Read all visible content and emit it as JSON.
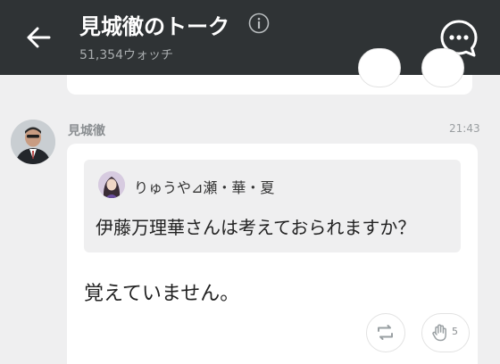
{
  "header": {
    "title": "見城徹のトーク",
    "watch_count": "51,354ウォッチ",
    "bg_color": "#2f3335",
    "icons": [
      "back-arrow-icon",
      "info-icon",
      "chat-bubble-icon"
    ]
  },
  "message": {
    "sender": "見城徹",
    "time": "21:43",
    "quote": {
      "name": "りゅうや⊿瀬・華・夏",
      "text": "伊藤万理華さんは考えておられますか？"
    },
    "text": "覚えていません。",
    "likes": "5",
    "icons": [
      "repost-icon",
      "clap-icon"
    ]
  },
  "colors": {
    "background": "#efeff0",
    "card": "#ffffff",
    "muted_text": "#8a8e91"
  }
}
